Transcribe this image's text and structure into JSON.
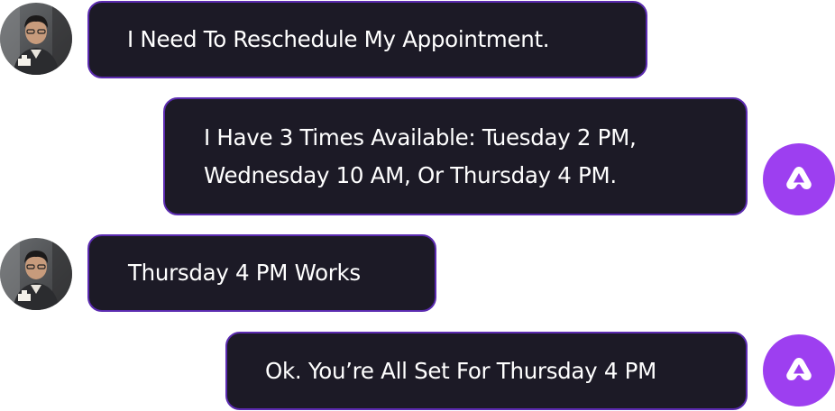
{
  "conversation": {
    "messages": [
      {
        "sender": "user",
        "avatar_icon": "user-photo-avatar",
        "text": "I Need To Reschedule My Appointment."
      },
      {
        "sender": "assistant",
        "avatar_icon": "assistant-logo-icon",
        "text": "I Have 3 Times Available: Tuesday 2 PM,\nWednesday 10 AM, Or Thursday 4 PM."
      },
      {
        "sender": "user",
        "avatar_icon": "user-photo-avatar",
        "text": "Thursday 4 PM Works"
      },
      {
        "sender": "assistant",
        "avatar_icon": "assistant-logo-icon",
        "text": "Ok. You’re All Set For Thursday 4 PM"
      }
    ]
  },
  "colors": {
    "bubble_background": "#1c1a26",
    "bubble_border": "#5b2bb0",
    "assistant_accent": "#9d3ff0",
    "text": "#ffffff"
  }
}
